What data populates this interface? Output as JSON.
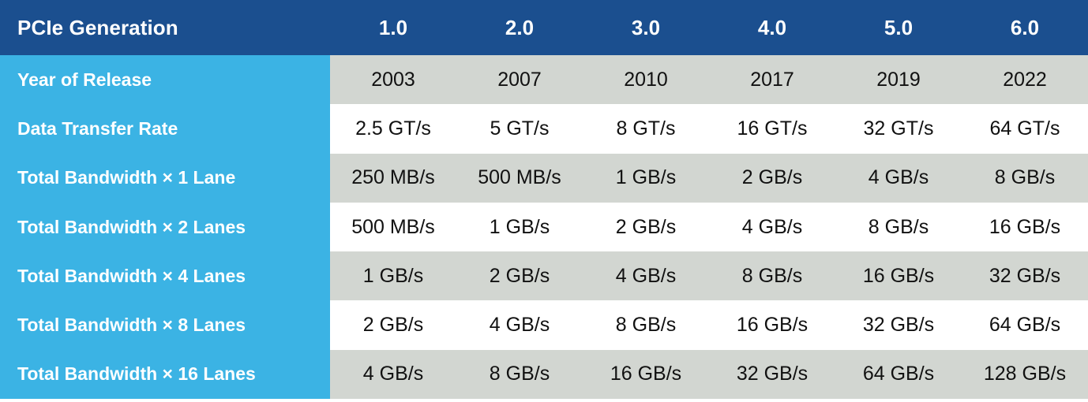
{
  "table": {
    "corner_label": "PCIe Generation",
    "generations": [
      "1.0",
      "2.0",
      "3.0",
      "4.0",
      "5.0",
      "6.0"
    ],
    "rows": [
      {
        "label": "Year of Release",
        "band": "gray",
        "values": [
          "2003",
          "2007",
          "2010",
          "2017",
          "2019",
          "2022"
        ]
      },
      {
        "label": "Data Transfer Rate",
        "band": "white",
        "values": [
          "2.5 GT/s",
          "5 GT/s",
          "8 GT/s",
          "16 GT/s",
          "32 GT/s",
          "64 GT/s"
        ]
      },
      {
        "label": "Total Bandwidth × 1 Lane",
        "band": "gray",
        "values": [
          "250 MB/s",
          "500 MB/s",
          "1 GB/s",
          "2 GB/s",
          "4 GB/s",
          "8 GB/s"
        ]
      },
      {
        "label": "Total Bandwidth × 2 Lanes",
        "band": "white",
        "values": [
          "500 MB/s",
          "1 GB/s",
          "2 GB/s",
          "4 GB/s",
          "8 GB/s",
          "16 GB/s"
        ]
      },
      {
        "label": "Total Bandwidth × 4 Lanes",
        "band": "gray",
        "values": [
          "1 GB/s",
          "2 GB/s",
          "4 GB/s",
          "8 GB/s",
          "16 GB/s",
          "32 GB/s"
        ]
      },
      {
        "label": "Total Bandwidth × 8 Lanes",
        "band": "white",
        "values": [
          "2 GB/s",
          "4 GB/s",
          "8 GB/s",
          "16 GB/s",
          "32 GB/s",
          "64 GB/s"
        ]
      },
      {
        "label": "Total Bandwidth × 16 Lanes",
        "band": "gray",
        "values": [
          "4 GB/s",
          "8 GB/s",
          "16 GB/s",
          "32 GB/s",
          "64 GB/s",
          "128 GB/s"
        ]
      }
    ]
  },
  "colors": {
    "header_background": "#1b4f8f",
    "label_background": "#3bb3e4",
    "row_band_gray": "#d2d6d1",
    "row_band_white": "#ffffff",
    "header_text": "#ffffff",
    "label_text": "#ffffff",
    "value_text": "#111111"
  }
}
